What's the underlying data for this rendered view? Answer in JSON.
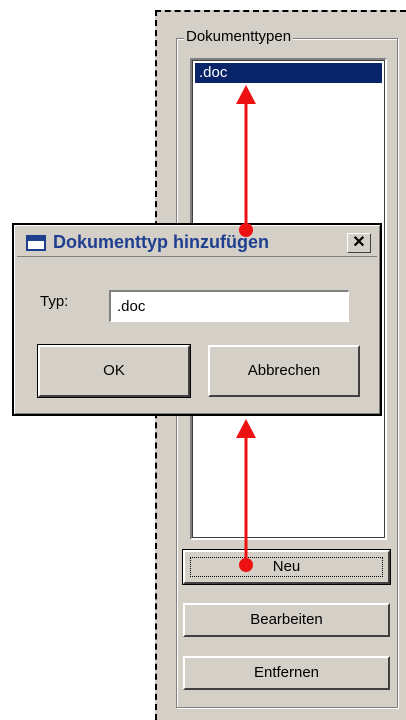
{
  "panel": {
    "group_title": "Dokumenttypen",
    "list_items": [
      ".doc"
    ],
    "buttons": {
      "new": "Neu",
      "edit": "Bearbeiten",
      "remove": "Entfernen"
    }
  },
  "dialog": {
    "title": "Dokumenttyp hinzufügen",
    "close_glyph": "✕",
    "type_label": "Typ:",
    "type_value": ".doc",
    "ok_label": "OK",
    "cancel_label": "Abbrechen"
  },
  "colors": {
    "selection": "#0a246a",
    "annotation": "#ee1111",
    "dialog_face": "#d4d0c8"
  },
  "icons": {
    "dialog_icon": "window-icon",
    "close": "close-icon",
    "annotation": "red-arrow"
  }
}
